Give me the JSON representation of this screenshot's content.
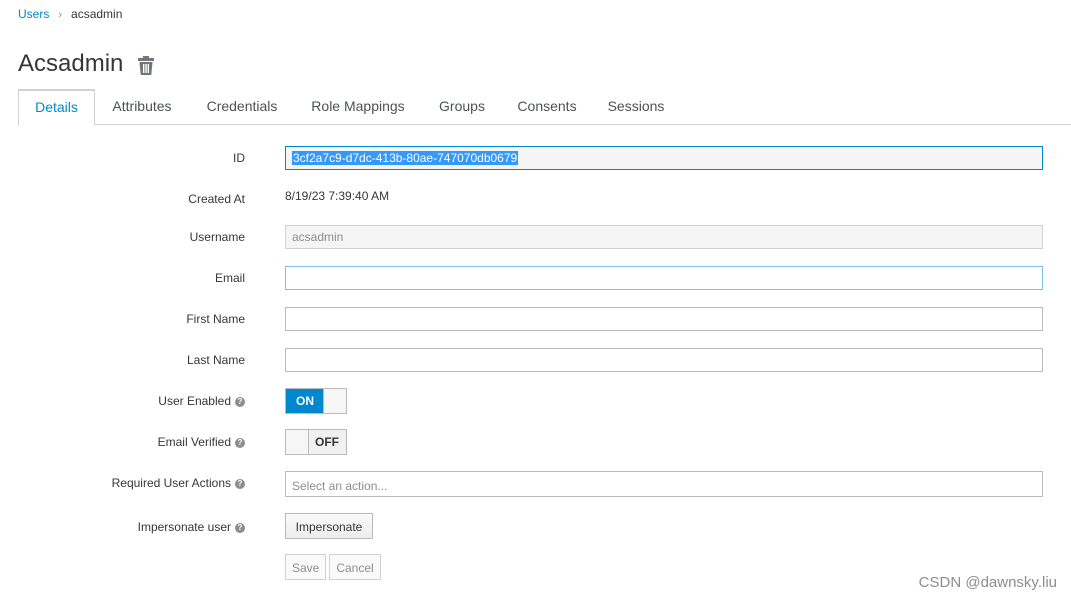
{
  "breadcrumb": {
    "parent": "Users",
    "current": "acsadmin"
  },
  "page": {
    "title": "Acsadmin"
  },
  "tabs": [
    {
      "label": "Details"
    },
    {
      "label": "Attributes"
    },
    {
      "label": "Credentials"
    },
    {
      "label": "Role Mappings"
    },
    {
      "label": "Groups"
    },
    {
      "label": "Consents"
    },
    {
      "label": "Sessions"
    }
  ],
  "form": {
    "id": {
      "label": "ID",
      "value": "3cf2a7c9-d7dc-413b-80ae-747070db0679"
    },
    "created_at": {
      "label": "Created At",
      "value": "8/19/23 7:39:40 AM"
    },
    "username": {
      "label": "Username",
      "value": "acsadmin"
    },
    "email": {
      "label": "Email",
      "value": ""
    },
    "first_name": {
      "label": "First Name",
      "value": ""
    },
    "last_name": {
      "label": "Last Name",
      "value": ""
    },
    "user_enabled": {
      "label": "User Enabled",
      "state": "ON"
    },
    "email_verified": {
      "label": "Email Verified",
      "state": "OFF"
    },
    "required_actions": {
      "label": "Required User Actions",
      "placeholder": "Select an action..."
    },
    "impersonate": {
      "label": "Impersonate user",
      "button": "Impersonate"
    }
  },
  "actions": {
    "save": "Save",
    "cancel": "Cancel"
  },
  "watermark": "CSDN @dawnsky.liu",
  "colors": {
    "accent": "#0088ce",
    "selection": "#3399ff"
  }
}
